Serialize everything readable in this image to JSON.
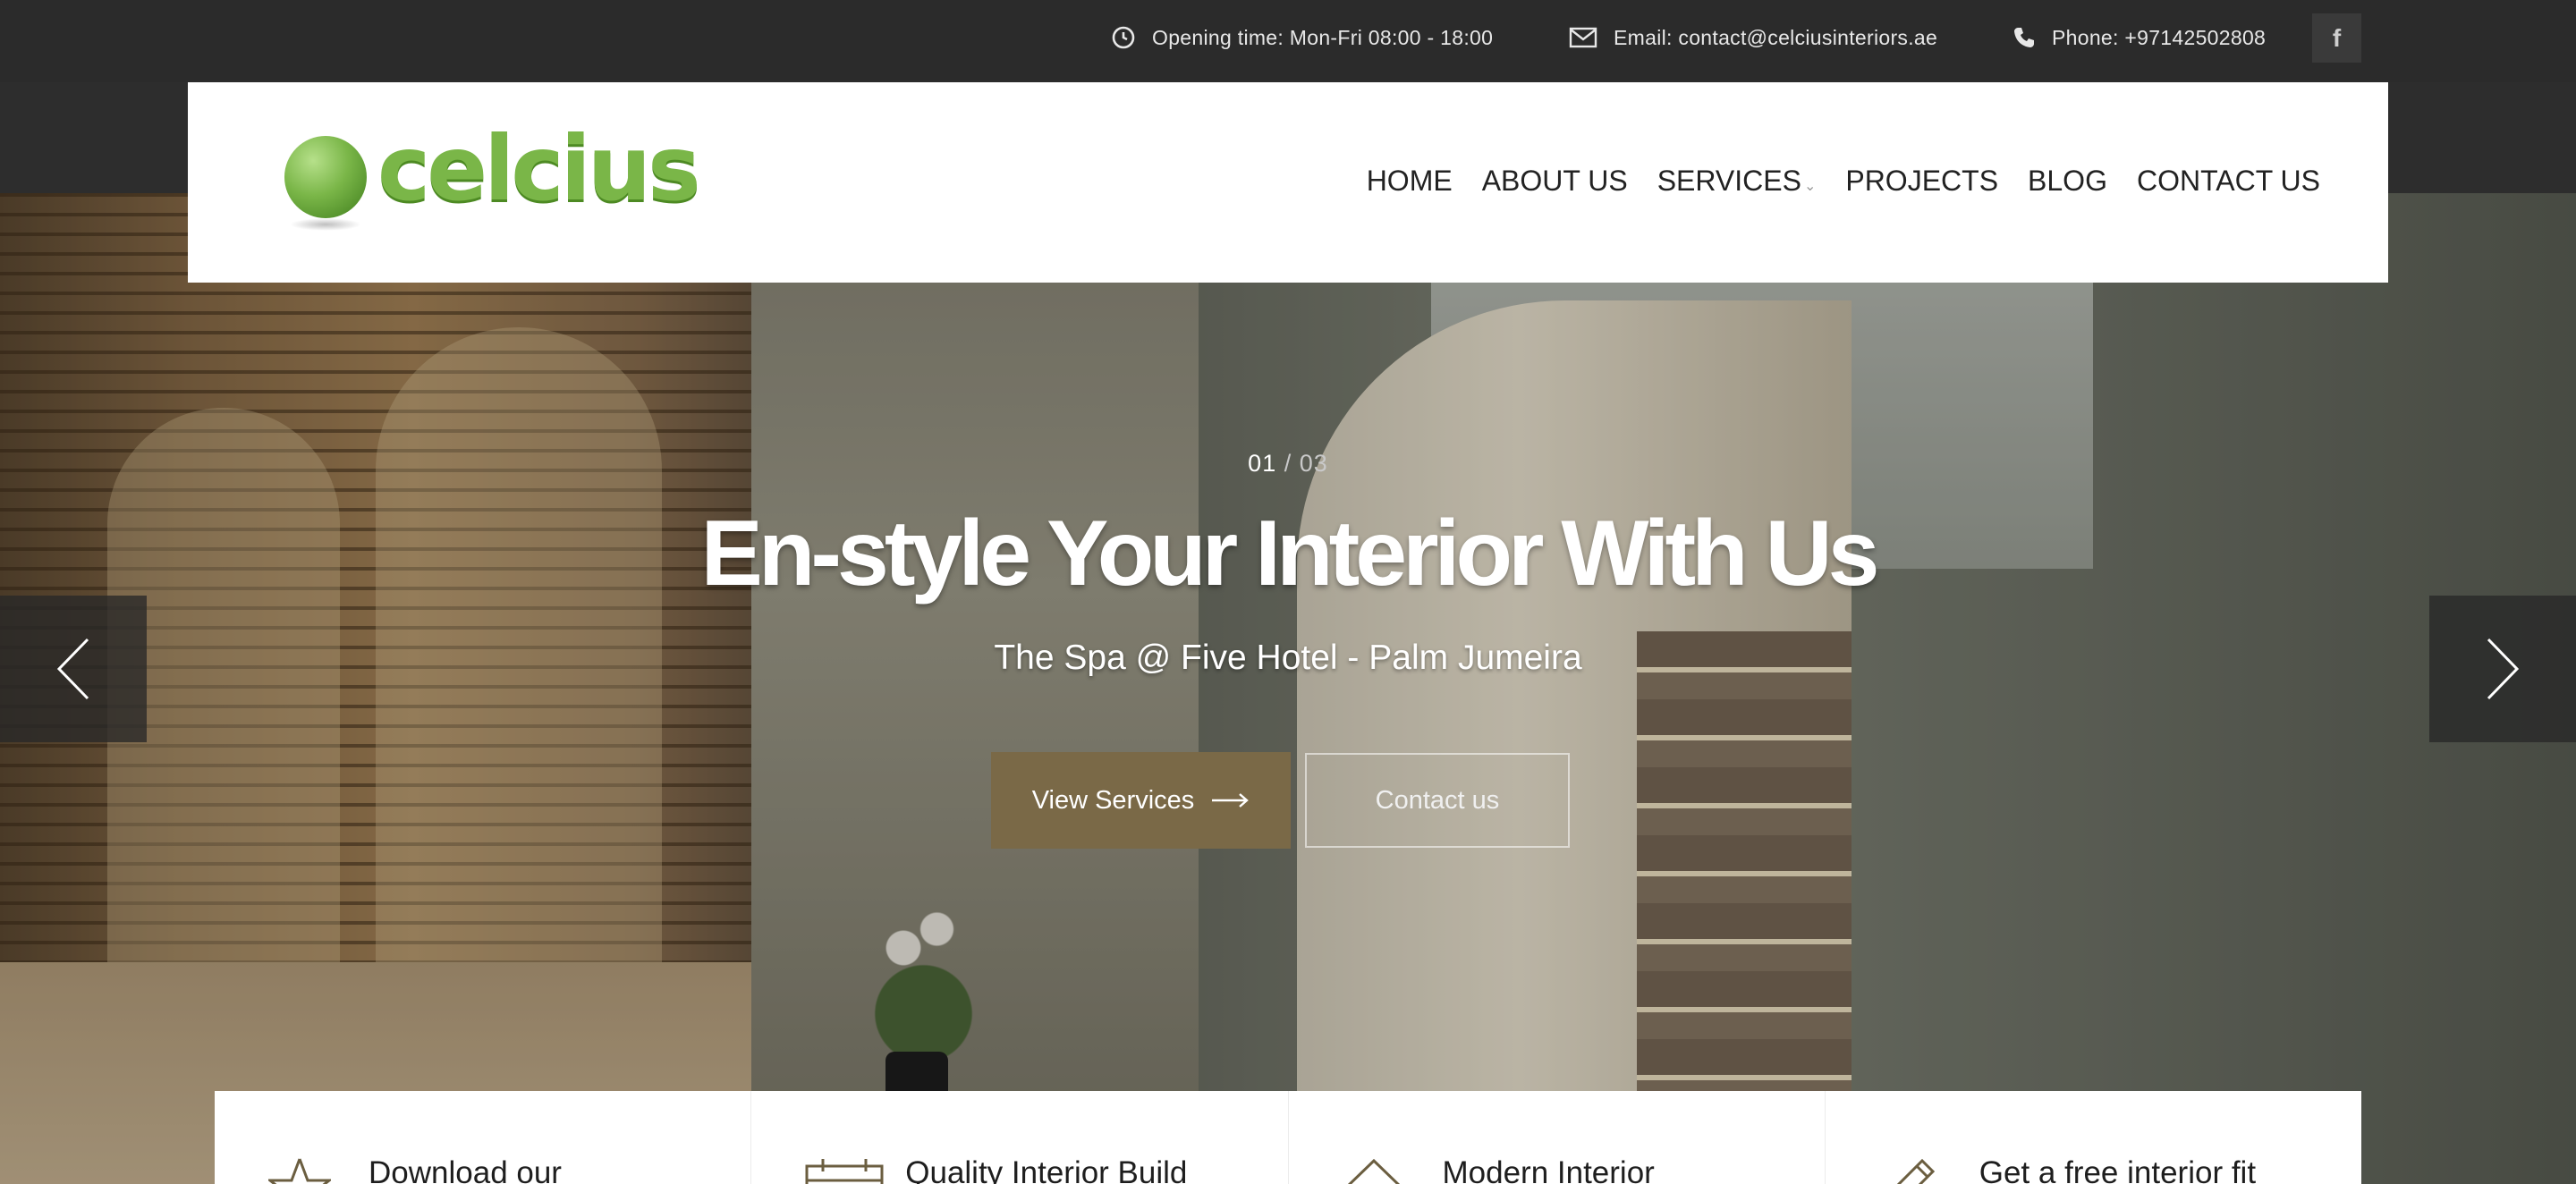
{
  "topbar": {
    "opening": "Opening time: Mon-Fri 08:00 - 18:00",
    "email": "Email: contact@celciusinteriors.ae",
    "phone": "Phone: +97142502808",
    "facebook_icon": "facebook-icon"
  },
  "logo": {
    "text": "celcius"
  },
  "nav": {
    "home": "HOME",
    "about": "ABOUT US",
    "services": "SERVICES",
    "projects": "PROJECTS",
    "blog": "BLOG",
    "contact": "CONTACT US"
  },
  "slider": {
    "current": "01",
    "separator": "/",
    "total": "03",
    "headline": "En-style Your Interior With Us",
    "subline": "The Spa @ Five Hotel - Palm Jumeira",
    "btn_services": "View Services",
    "btn_contact": "Contact us"
  },
  "features": [
    {
      "title": "Download our",
      "icon": "star-icon"
    },
    {
      "title": "Quality Interior Build",
      "icon": "calendar-icon"
    },
    {
      "title": "Modern Interior",
      "icon": "house-icon"
    },
    {
      "title": "Get a free interior fit",
      "icon": "pencil-icon"
    }
  ],
  "colors": {
    "brand_green": "#7ab648",
    "button_brown": "#7a6947",
    "topbar_bg": "#2b2b2b"
  }
}
